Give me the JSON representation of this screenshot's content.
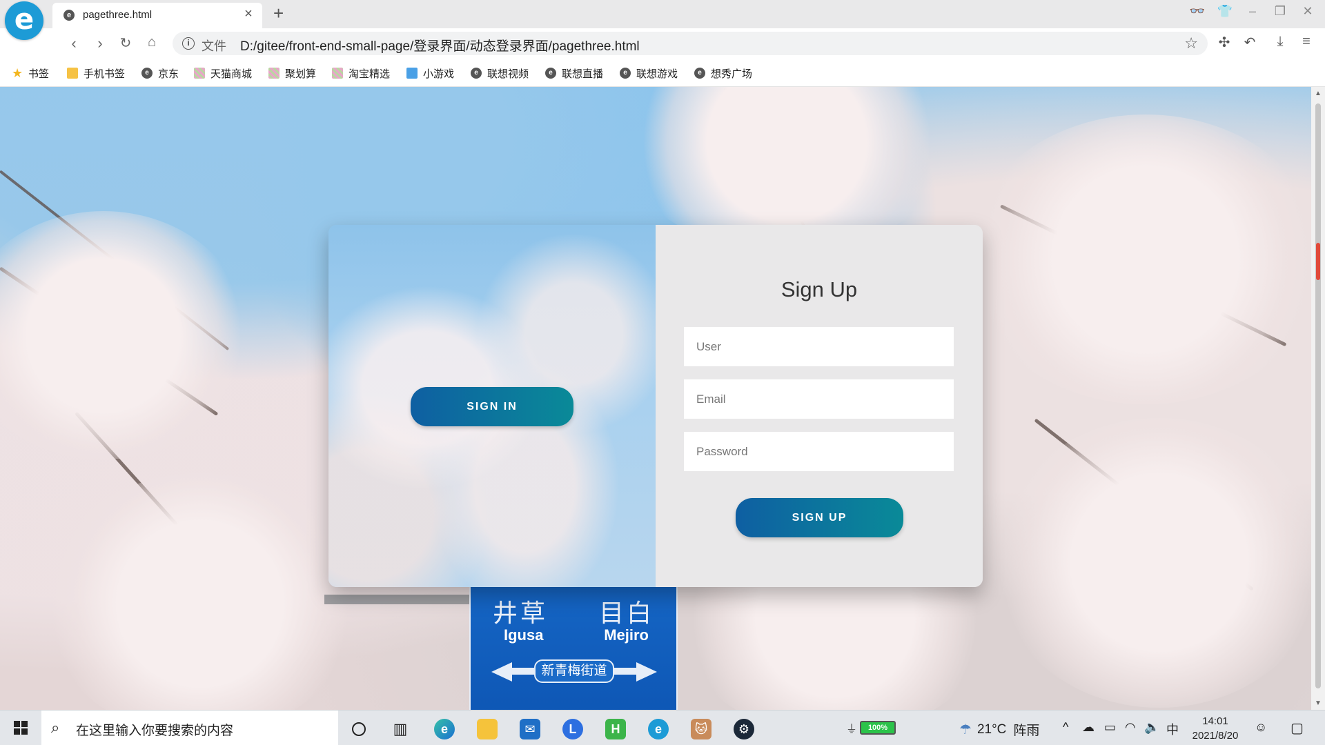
{
  "browser": {
    "tab_title": "pagethree.html",
    "scheme_label": "文件",
    "url": "D:/gitee/front-end-small-page/登录界面/动态登录界面/pagethree.html"
  },
  "bookmarks": [
    {
      "label": "书签",
      "icon": "star-icon"
    },
    {
      "label": "手机书签",
      "icon": "phone-icon"
    },
    {
      "label": "京东",
      "icon": "e-icon"
    },
    {
      "label": "天猫商城",
      "icon": "image-icon"
    },
    {
      "label": "聚划算",
      "icon": "image-icon"
    },
    {
      "label": "淘宝精选",
      "icon": "image-icon"
    },
    {
      "label": "小游戏",
      "icon": "game-icon"
    },
    {
      "label": "联想视频",
      "icon": "e-icon"
    },
    {
      "label": "联想直播",
      "icon": "e-icon"
    },
    {
      "label": "联想游戏",
      "icon": "e-icon"
    },
    {
      "label": "想秀广场",
      "icon": "e-icon"
    }
  ],
  "page": {
    "signin_button": "SIGN IN",
    "signup_title": "Sign Up",
    "user_placeholder": "User",
    "email_placeholder": "Email",
    "password_placeholder": "Password",
    "signup_button": "SIGN UP"
  },
  "background_sign": {
    "kanji_left": "井草",
    "kanji_right": "目白",
    "romaji_left": "Igusa",
    "romaji_right": "Mejiro",
    "road_name": "新青梅街道"
  },
  "taskbar": {
    "search_placeholder": "在这里输入你要搜索的内容",
    "battery": "100%",
    "temperature": "21°C",
    "weather": "阵雨",
    "ime": "中",
    "time": "14:01",
    "date": "2021/8/20"
  },
  "colors": {
    "button_gradient_start": "#0e5fa2",
    "button_gradient_end": "#0a8a98",
    "card_right_bg": "#e9e8e9"
  }
}
